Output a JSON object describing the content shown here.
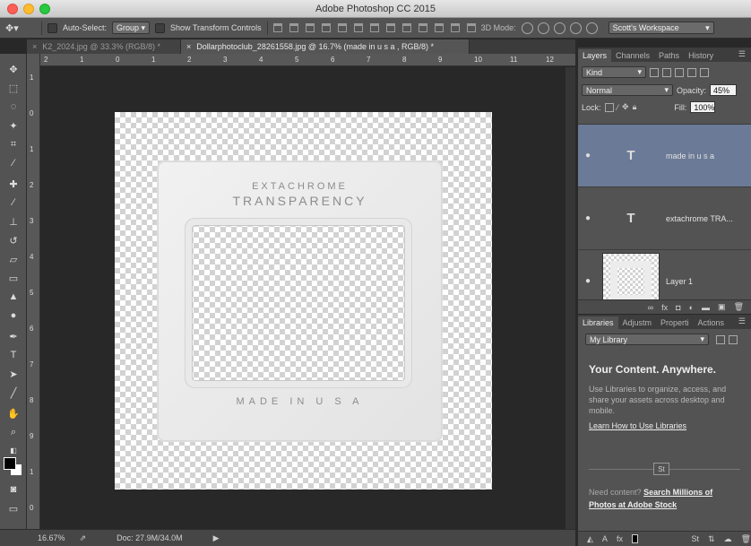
{
  "app": {
    "title": "Adobe Photoshop CC 2015"
  },
  "options": {
    "tool_icon": "move-tool-icon",
    "auto_select_label": "Auto-Select:",
    "auto_select_value": "Group",
    "show_transform_label": "Show Transform Controls",
    "mode_3d_label": "3D Mode:",
    "workspace_value": "Scott's Workspace"
  },
  "tabs": [
    {
      "label": "K2_2024.jpg @ 33.3% (RGB/8) *"
    },
    {
      "label": "Dollarphotoclub_28261558.jpg @ 16.7% (made in u s a , RGB/8) *"
    }
  ],
  "rulers": {
    "top": [
      "2",
      "1",
      "0",
      "1",
      "2",
      "3",
      "4",
      "5",
      "6",
      "7",
      "8",
      "9",
      "10",
      "11",
      "12"
    ],
    "left": [
      "1",
      "0",
      "1",
      "2",
      "3",
      "4",
      "5",
      "6",
      "7",
      "8",
      "9",
      "1",
      "0"
    ]
  },
  "canvas": {
    "line1": "EXTACHROME",
    "line2": "TRANSPARENCY",
    "line3": "MADE IN U S A"
  },
  "status": {
    "zoom": "16.67%",
    "doc": "Doc: 27.9M/34.0M"
  },
  "layers_panel": {
    "tabs": [
      "Layers",
      "Channels",
      "Paths",
      "History"
    ],
    "filter_label": "Kind",
    "blend_mode": "Normal",
    "opacity_label": "Opacity:",
    "opacity_value": "45%",
    "lock_label": "Lock:",
    "fill_label": "Fill:",
    "fill_value": "100%",
    "layers": [
      {
        "name": "made in u s a",
        "type": "text",
        "selected": true
      },
      {
        "name": "extachrome TRA...",
        "type": "text",
        "selected": false
      },
      {
        "name": "Layer 1",
        "type": "image",
        "selected": false
      }
    ],
    "footer_icons": [
      "link-icon",
      "fx-icon",
      "mask-icon",
      "adjustment-icon",
      "folder-icon",
      "new-layer-icon",
      "trash-icon"
    ]
  },
  "libraries_panel": {
    "tabs": [
      "Libraries",
      "Adjustm",
      "Properti",
      "Actions"
    ],
    "library_select": "My Library",
    "heading": "Your Content. Anywhere.",
    "description": "Use Libraries to organize, access, and share your assets across desktop and mobile.",
    "learn_link": "Learn How to Use Libraries",
    "st_badge": "St",
    "need_text": "Need content?",
    "stock_link": "Search Millions of Photos at Adobe Stock"
  }
}
